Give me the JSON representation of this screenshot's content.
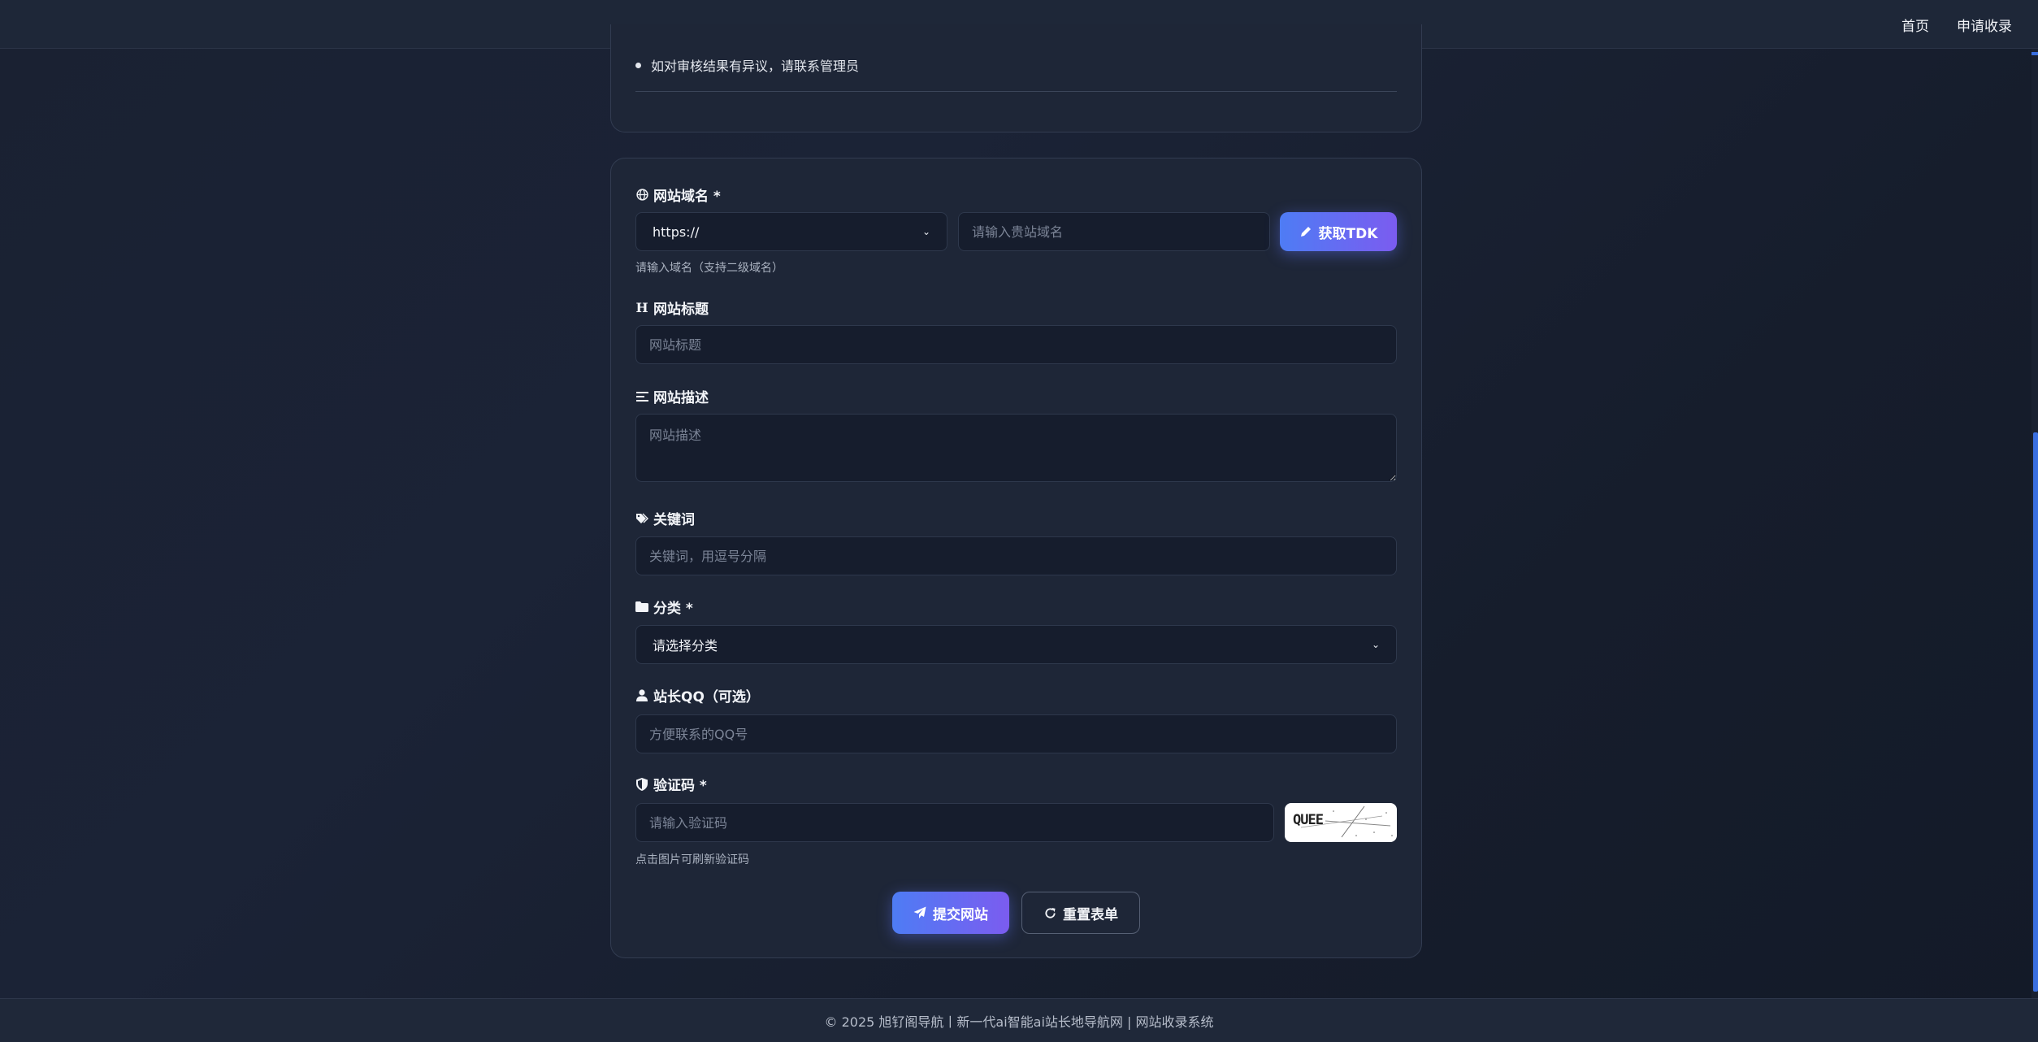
{
  "nav": {
    "links": [
      {
        "label": "首页"
      },
      {
        "label": "申请收录"
      }
    ]
  },
  "notes": {
    "items": [
      "如对审核结果有异议，请联系管理员"
    ]
  },
  "form": {
    "domain": {
      "label": "网站域名 *",
      "protocol_selected": "https://",
      "placeholder": "请输入贵站域名",
      "value": "",
      "fetch_button": "获取TDK",
      "help": "请输入域名（支持二级域名）"
    },
    "title": {
      "label": "网站标题",
      "placeholder": "网站标题",
      "value": ""
    },
    "description": {
      "label": "网站描述",
      "placeholder": "网站描述",
      "value": ""
    },
    "keywords": {
      "label": "关键词",
      "placeholder": "关键词，用逗号分隔",
      "value": ""
    },
    "category": {
      "label": "分类 *",
      "selected": "请选择分类"
    },
    "qq": {
      "label": "站长QQ（可选）",
      "placeholder": "方便联系的QQ号",
      "value": ""
    },
    "captcha": {
      "label": "验证码 *",
      "placeholder": "请输入验证码",
      "value": "",
      "image_text": "QUEE",
      "help": "点击图片可刷新验证码"
    },
    "submit_button": "提交网站",
    "reset_button": "重置表单"
  },
  "footer": {
    "text": "© 2025 旭钌阁导航丨新一代ai智能ai站长地导航网 | 网站收录系统"
  },
  "colors": {
    "accent_start": "#4e7cf4",
    "accent_end": "#7b5cf0",
    "background": "#1a2132",
    "card": "#1e2637"
  }
}
